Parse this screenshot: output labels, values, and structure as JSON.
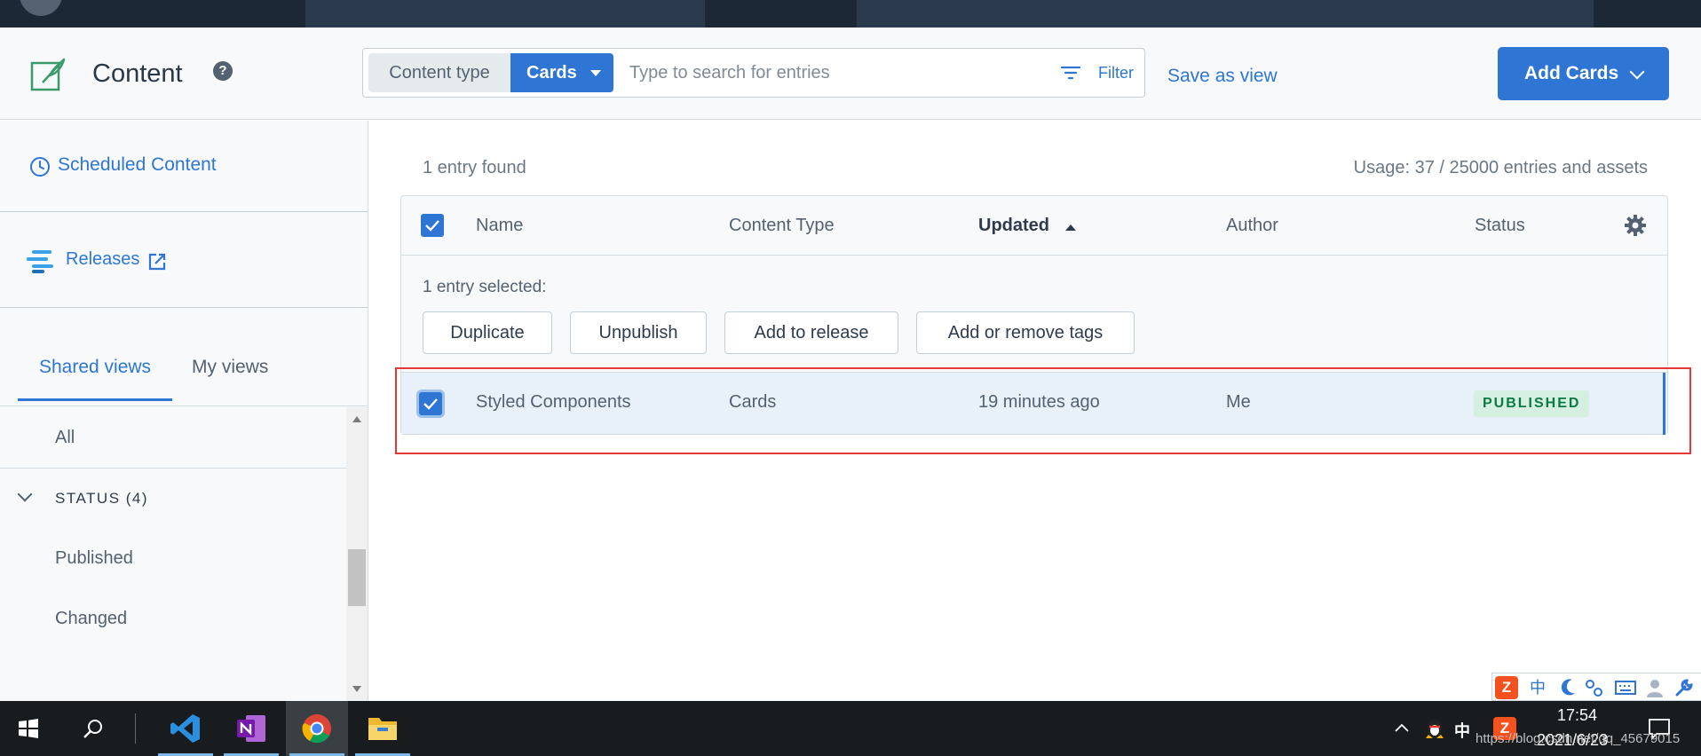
{
  "header": {
    "title": "Content",
    "content_type_label": "Content type",
    "content_type_value": "Cards",
    "search_placeholder": "Type to search for entries",
    "filter_label": "Filter",
    "save_as_view": "Save as view",
    "add_button": "Add Cards"
  },
  "sidebar": {
    "scheduled_content": "Scheduled Content",
    "releases": "Releases",
    "tabs": [
      {
        "label": "Shared views",
        "active": true
      },
      {
        "label": "My views",
        "active": false
      }
    ],
    "all_label": "All",
    "group_label": "STATUS (4)",
    "items": [
      "Published",
      "Changed"
    ]
  },
  "main": {
    "entries_found": "1 entry found",
    "usage": "Usage: 37 / 25000 entries and assets",
    "columns": [
      "Name",
      "Content Type",
      "Updated",
      "Author",
      "Status"
    ],
    "bulk_label": "1 entry selected:",
    "bulk_actions": [
      "Duplicate",
      "Unpublish",
      "Add to release",
      "Add or remove tags"
    ],
    "rows": [
      {
        "name": "Styled Components",
        "content_type": "Cards",
        "updated": "19 minutes ago",
        "author": "Me",
        "status": "PUBLISHED"
      }
    ]
  },
  "ime": {
    "chinese_char": "中"
  },
  "taskbar": {
    "time": "17:54",
    "date": "2021/6/23",
    "ime_char": "中"
  },
  "watermark": "https://blog.csdn.net/qq_45679015",
  "colors": {
    "accent": "#2e75d4",
    "published_bg": "#d5f0e0",
    "published_fg": "#0b7a45",
    "highlight": "#e53935"
  }
}
